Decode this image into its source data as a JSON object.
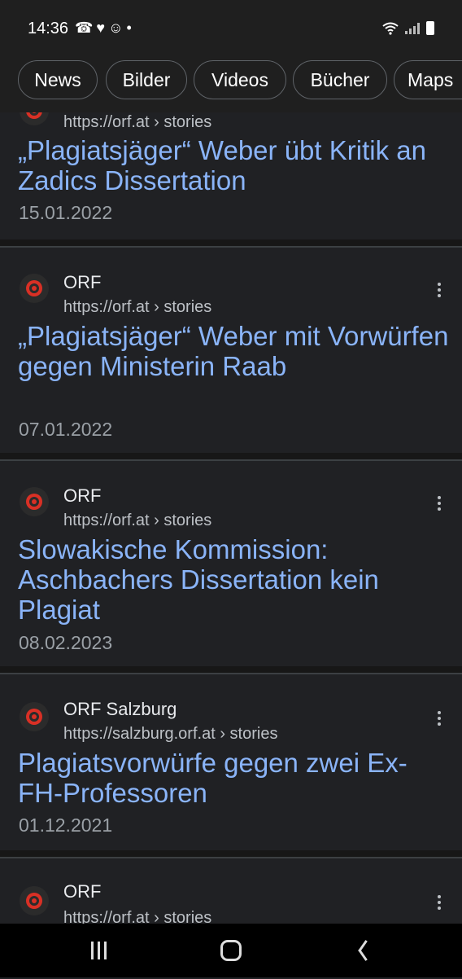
{
  "status_bar": {
    "time": "14:36",
    "left_icons": [
      "missed-call-icon",
      "heart-icon",
      "emoji-icon",
      "dot-icon"
    ],
    "left_icon_glyphs": "☎♥☺•"
  },
  "chips": [
    {
      "label": "News"
    },
    {
      "label": "Bilder"
    },
    {
      "label": "Videos"
    },
    {
      "label": "Bücher"
    },
    {
      "label": "Maps"
    }
  ],
  "results": [
    {
      "site": "",
      "url": "https://orf.at › stories",
      "title": "„Plagiatsjäger“ Weber übt Kritik an Zadics Dissertation",
      "date": "15.01.2022"
    },
    {
      "site": "ORF",
      "url": "https://orf.at › stories",
      "title": "„Plagiatsjäger“ Weber mit Vorwürfen gegen Ministerin Raab",
      "date": "07.01.2022"
    },
    {
      "site": "ORF",
      "url": "https://orf.at › stories",
      "title": "Slowakische Kommission: Aschbachers Dissertation kein Plagiat",
      "date": "08.02.2023"
    },
    {
      "site": "ORF Salzburg",
      "url": "https://salzburg.orf.at › stories",
      "title": "Plagiatsvorwürfe gegen zwei Ex-FH-Professoren",
      "date": "01.12.2021"
    },
    {
      "site": "ORF",
      "url": "https://orf.at › stories",
      "title": "",
      "date": ""
    }
  ],
  "peek_url": "https://orf.at › stories",
  "colors": {
    "background": "#202124",
    "title_link": "#8ab4f8",
    "url_text": "#bdc1c6",
    "favicon_red": "#d93025"
  }
}
